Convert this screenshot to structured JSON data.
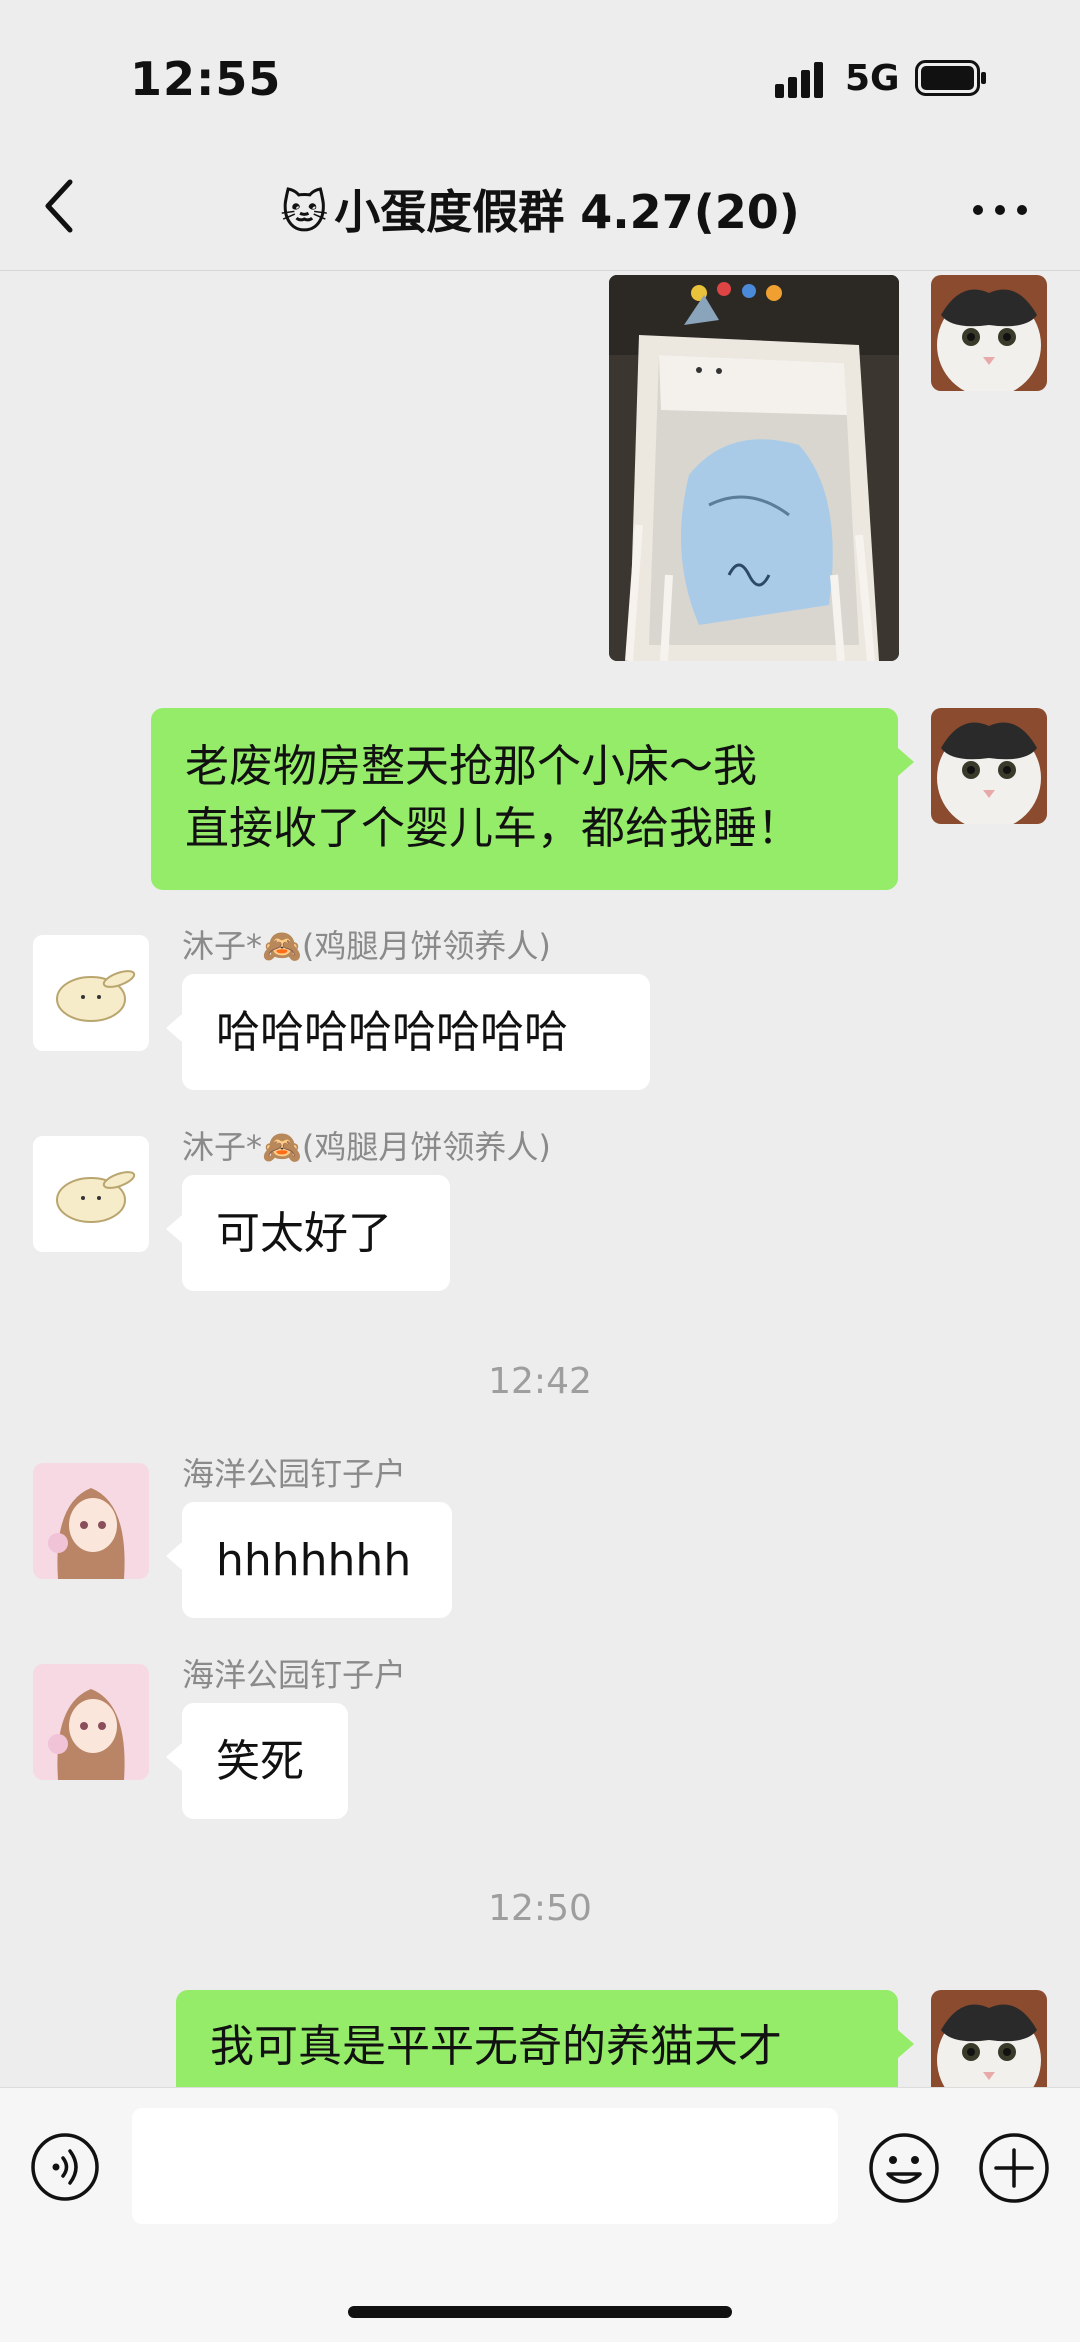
{
  "status_bar": {
    "time": "12:55",
    "network": "5G"
  },
  "header": {
    "title": "小蛋度假群 4.27(20)",
    "title_emoji": "🐱"
  },
  "messages": [
    {
      "type": "image_self",
      "alt": ""
    },
    {
      "type": "text_self",
      "lines": [
        "老废物房整天抢那个小床～我",
        "直接收了个婴儿车，都给我睡！"
      ]
    },
    {
      "type": "text_other",
      "sender": "沐子*🙈(鸡腿月饼领养人)",
      "text": "哈哈哈哈哈哈哈哈"
    },
    {
      "type": "text_other",
      "sender": "沐子*🙈(鸡腿月饼领养人)",
      "text": "可太好了"
    },
    {
      "type": "time",
      "text": "12:42"
    },
    {
      "type": "text_other",
      "sender": "海洋公园钉子户",
      "text": "hhhhhhh"
    },
    {
      "type": "text_other",
      "sender": "海洋公园钉子户",
      "text": "笑死"
    },
    {
      "type": "time",
      "text": "12:50"
    },
    {
      "type": "text_self",
      "text": "我可真是平平无奇的养猫天才"
    }
  ],
  "icons": {
    "back": "chevron-left-icon",
    "more": "more-dots-icon",
    "voice": "voice-icon",
    "emoji": "emoji-icon",
    "plus": "plus-icon"
  },
  "colors": {
    "self_bubble": "#95ec69",
    "other_bubble": "#ffffff",
    "background": "#ededed"
  }
}
